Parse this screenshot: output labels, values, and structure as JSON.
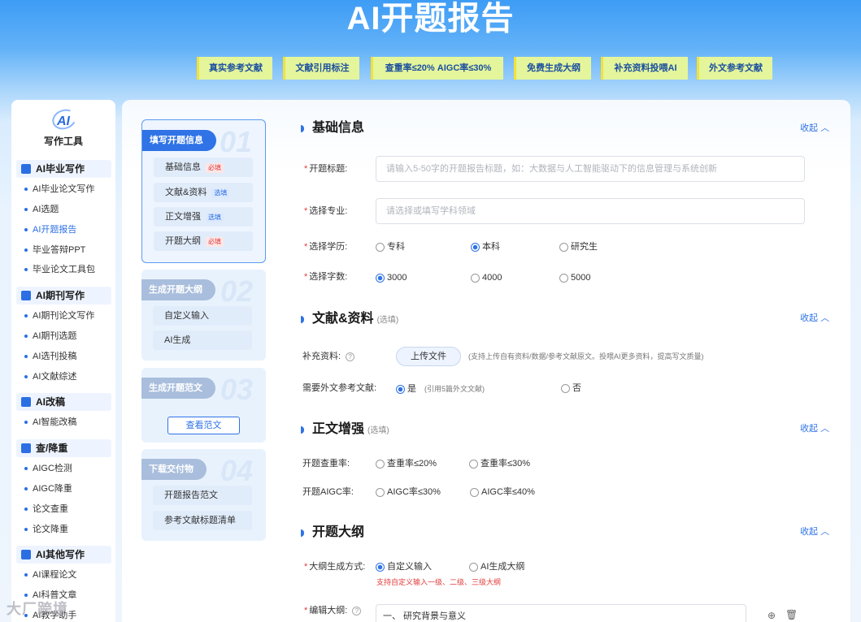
{
  "header": {
    "title": "AI开题报告"
  },
  "feature_tags": [
    "真实参考文献",
    "文献引用标注",
    "查重率≤20%  AIGC率≤30%",
    "免费生成大纲",
    "补充资料投喂AI",
    "外文参考文献"
  ],
  "sidebar": {
    "logo_text": "AI",
    "caption": "写作工具",
    "groups": [
      {
        "label": "AI毕业写作",
        "items": [
          "AI毕业论文写作",
          "AI选题",
          "AI开题报告",
          "毕业答辩PPT",
          "毕业论文工具包"
        ]
      },
      {
        "label": "AI期刊写作",
        "items": [
          "AI期刊论文写作",
          "AI期刊选题",
          "AI选刊投稿",
          "AI文献综述"
        ]
      },
      {
        "label": "AI改稿",
        "items": [
          "AI智能改稿"
        ]
      },
      {
        "label": "查/降重",
        "items": [
          "AIGC检测",
          "AIGC降重",
          "论文查重",
          "论文降重"
        ]
      },
      {
        "label": "AI其他写作",
        "items": [
          "AI课程论文",
          "AI科普文章",
          "AI教学助手"
        ]
      }
    ]
  },
  "steps": [
    {
      "num": "01",
      "label": "填写开题信息",
      "subs": [
        {
          "label": "基础信息",
          "badge": "必填"
        },
        {
          "label": "文献&资料",
          "badge": "选填"
        },
        {
          "label": "正文增强",
          "badge": "选填"
        },
        {
          "label": "开题大纲",
          "badge": "必填"
        }
      ]
    },
    {
      "num": "02",
      "label": "生成开题大纲",
      "subs": [
        {
          "label": "自定义输入"
        },
        {
          "label": "AI生成"
        }
      ]
    },
    {
      "num": "03",
      "label": "生成开题范文",
      "button": "查看范文"
    },
    {
      "num": "04",
      "label": "下载交付物",
      "subs": [
        {
          "label": "开题报告范文"
        },
        {
          "label": "参考文献标题清单"
        }
      ]
    }
  ],
  "collapse_label": "收起",
  "basic": {
    "title": "基础信息",
    "topic_label": "开题标题:",
    "topic_placeholder": "请输入5-50字的开题报告标题，如：大数据与人工智能驱动下的信息管理与系统创新",
    "major_label": "选择专业:",
    "major_placeholder": "请选择或填写学科领域",
    "degree_label": "选择学历:",
    "degree_options": [
      "专科",
      "本科",
      "研究生"
    ],
    "degree_selected": "本科",
    "words_label": "选择字数:",
    "words_options": [
      "3000",
      "4000",
      "5000"
    ],
    "words_selected": "3000"
  },
  "literature": {
    "title": "文献&资料",
    "hint": "(选填)",
    "supplement_label": "补充资料:",
    "upload_label": "上传文件",
    "upload_hint": "(支持上传自有资料/数据/参考文献原文。投喂AI更多资料，提高写文质量)",
    "foreign_label": "需要外文参考文献:",
    "yes": "是",
    "yes_hint": "(引用5篇外文文献)",
    "no": "否"
  },
  "enhance": {
    "title": "正文增强",
    "hint": "(选填)",
    "dup_label": "开题查重率:",
    "dup_options": [
      "查重率≤20%",
      "查重率≤30%"
    ],
    "aigc_label": "开题AIGC率:",
    "aigc_options": [
      "AIGC率≤30%",
      "AIGC率≤40%"
    ]
  },
  "outline": {
    "title": "开题大纲",
    "method_label": "大纲生成方式:",
    "method_options": [
      "自定义输入",
      "AI生成大纲"
    ],
    "method_selected": "自定义输入",
    "method_hint": "支持自定义输入一级、二级、三级大纲",
    "edit_label": "编辑大纲:",
    "first_item": "一、 研究背景与意义"
  },
  "watermark": "大厂跨境"
}
